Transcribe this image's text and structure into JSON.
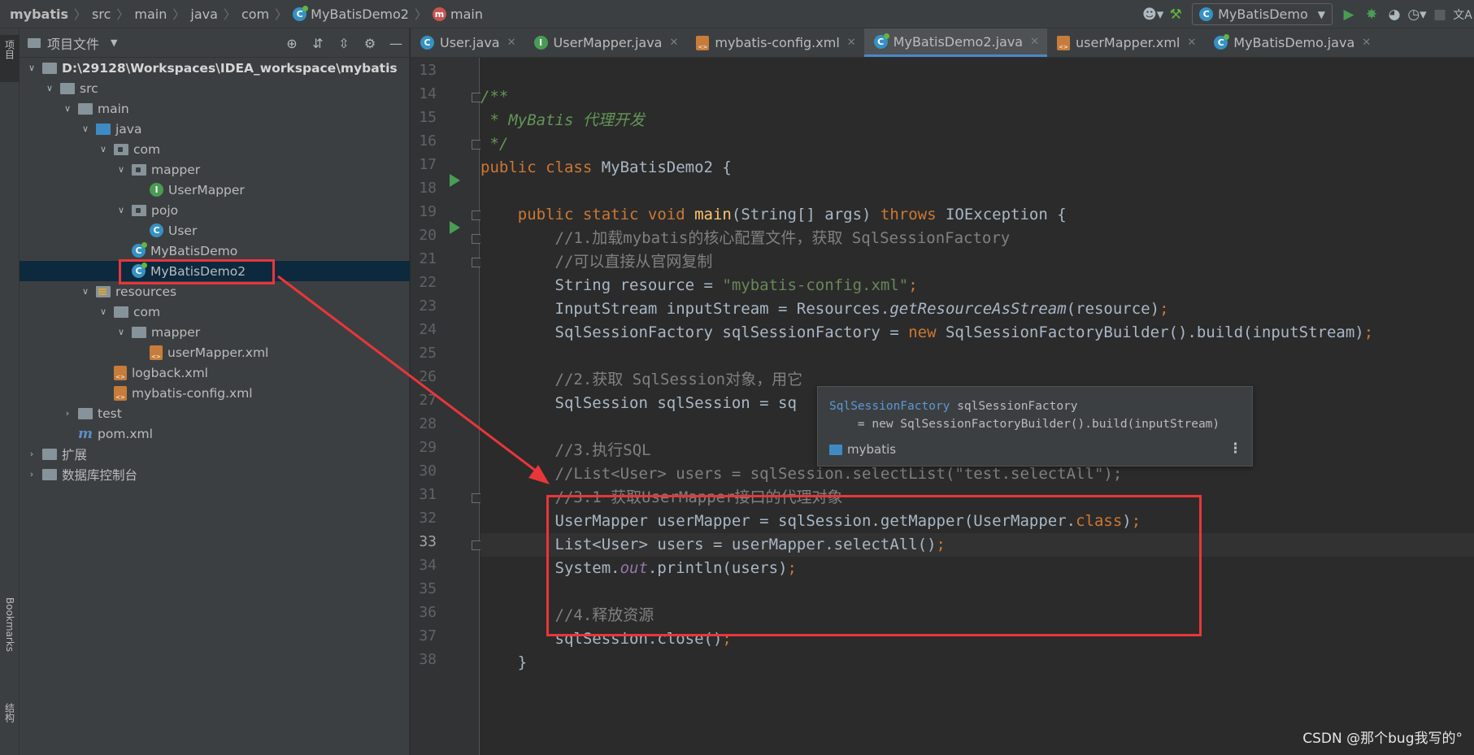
{
  "breadcrumb": {
    "items": [
      "mybatis",
      "src",
      "main",
      "java",
      "com",
      "MyBatisDemo2",
      "main"
    ]
  },
  "toolbar": {
    "run_config": "MyBatisDemo",
    "icons": [
      "user-icon",
      "hammer-icon",
      "run-icon",
      "debug-icon",
      "coverage-icon",
      "profile-icon",
      "stop-icon",
      "translate-icon"
    ]
  },
  "left_strip": {
    "project_tab": "项目",
    "bookmarks_tab": "Bookmarks",
    "structure_tab": "结构"
  },
  "project_panel": {
    "title": "项目文件",
    "tree": [
      {
        "label": "D:\\29128\\Workspaces\\IDEA_workspace\\mybatis",
        "bold_part": "mybatis"
      },
      {
        "label": "src"
      },
      {
        "label": "main"
      },
      {
        "label": "java"
      },
      {
        "label": "com"
      },
      {
        "label": "mapper"
      },
      {
        "label": "UserMapper"
      },
      {
        "label": "pojo"
      },
      {
        "label": "User"
      },
      {
        "label": "MyBatisDemo"
      },
      {
        "label": "MyBatisDemo2"
      },
      {
        "label": "resources"
      },
      {
        "label": "com"
      },
      {
        "label": "mapper"
      },
      {
        "label": "userMapper.xml"
      },
      {
        "label": "logback.xml"
      },
      {
        "label": "mybatis-config.xml"
      },
      {
        "label": "test"
      },
      {
        "label": "pom.xml"
      },
      {
        "label": "扩展"
      },
      {
        "label": "数据库控制台"
      }
    ]
  },
  "tabs": [
    {
      "label": "User.java"
    },
    {
      "label": "UserMapper.java"
    },
    {
      "label": "mybatis-config.xml"
    },
    {
      "label": "MyBatisDemo2.java"
    },
    {
      "label": "userMapper.xml"
    },
    {
      "label": "MyBatisDemo.java"
    }
  ],
  "code": {
    "line_numbers": [
      "13",
      "14",
      "15",
      "16",
      "17",
      "18",
      "19",
      "20",
      "21",
      "22",
      "23",
      "24",
      "25",
      "26",
      "27",
      "28",
      "29",
      "30",
      "31",
      "32",
      "33",
      "34",
      "35",
      "36",
      "37",
      "38"
    ],
    "current_line": "33",
    "lines": {
      "l14": "/**",
      "l15": " * MyBatis 代理开发",
      "l16": " */",
      "l17_a": "public class ",
      "l17_b": "MyBatisDemo2 {",
      "l19_a": "    public static void ",
      "l19_b": "main",
      "l19_c": "(String[] args) ",
      "l19_d": "throws ",
      "l19_e": "IOException {",
      "l20": "        //1.加载mybatis的核心配置文件，获取 SqlSessionFactory",
      "l21": "        //可以直接从官网复制",
      "l22_a": "        String resource = ",
      "l22_b": "\"mybatis-config.xml\"",
      "l22_c": ";",
      "l23_a": "        InputStream inputStream = Resources.",
      "l23_b": "getResourceAsStream",
      "l23_c": "(resource)",
      "l23_d": ";",
      "l24_a": "        SqlSessionFactory sqlSessionFactory = ",
      "l24_b": "new ",
      "l24_c": "SqlSessionFactoryBuilder().build(inputStream)",
      "l24_d": ";",
      "l26": "        //2.获取 SqlSession对象，用它",
      "l27": "        SqlSession sqlSession = sq",
      "l29": "        //3.执行SQL",
      "l30": "        //List<User> users = sqlSession.selectList(\"test.selectAll\");",
      "l31": "        //3.1 获取UserMapper接口的代理对象",
      "l32_a": "        UserMapper userMapper = sqlSession.getMapper(UserMapper.",
      "l32_b": "class",
      "l32_c": ")",
      "l32_d": ";",
      "l33_a": "        List<User> users = userMapper.selectAll()",
      "l33_b": ";",
      "l34_a": "        System.",
      "l34_b": "out",
      "l34_c": ".println(users)",
      "l34_d": ";",
      "l36": "        //4.释放资源",
      "l37_a": "        sqlSession.close()",
      "l37_b": ";",
      "l38": "    }"
    }
  },
  "popup": {
    "type": "SqlSessionFactory",
    "var": " sqlSessionFactory",
    "line2": "    = new SqlSessionFactoryBuilder().build(inputStream)",
    "module": "mybatis"
  },
  "watermark": "CSDN @那个bug我写的°",
  "colors": {
    "annotation_red": "#e8363a",
    "keyword": "#cc7832",
    "string": "#6a8759",
    "comment": "#808080"
  }
}
